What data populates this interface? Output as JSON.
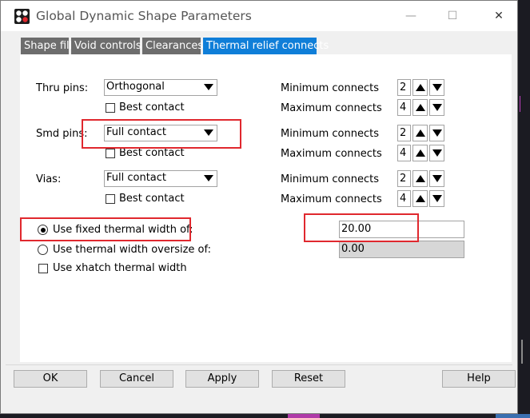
{
  "window": {
    "title": "Global Dynamic Shape Parameters",
    "close_glyph": "✕",
    "minimize_glyph": "—",
    "maximize_glyph": "☐"
  },
  "tabs": [
    {
      "label": "Shape fill"
    },
    {
      "label": "Void controls"
    },
    {
      "label": "Clearances"
    },
    {
      "label": "Thermal relief connects",
      "active": true
    }
  ],
  "rows": [
    {
      "label": "Thru pins:",
      "select": "Orthogonal",
      "best_contact": "Best contact",
      "min_label": "Minimum connects",
      "min": "2",
      "max_label": "Maximum connects",
      "max": "4"
    },
    {
      "label": "Smd pins:",
      "select": "Full contact",
      "best_contact": "Best contact",
      "min_label": "Minimum connects",
      "min": "2",
      "max_label": "Maximum connects",
      "max": "4"
    },
    {
      "label": "Vias:",
      "select": "Full contact",
      "best_contact": "Best contact",
      "min_label": "Minimum connects",
      "min": "2",
      "max_label": "Maximum connects",
      "max": "4"
    }
  ],
  "width_options": {
    "fixed_label": "Use fixed thermal width of:",
    "fixed_value": "20.00",
    "oversize_label": "Use thermal width oversize of:",
    "oversize_value": "0.00",
    "xhatch_label": "Use xhatch thermal width",
    "selected": "fixed"
  },
  "buttons": {
    "ok": "OK",
    "cancel": "Cancel",
    "apply": "Apply",
    "reset": "Reset",
    "help": "Help"
  },
  "colors": {
    "active_tab": "#0f7ed8",
    "inactive_tab": "#6d6d6d",
    "highlight": "#e0282e"
  }
}
